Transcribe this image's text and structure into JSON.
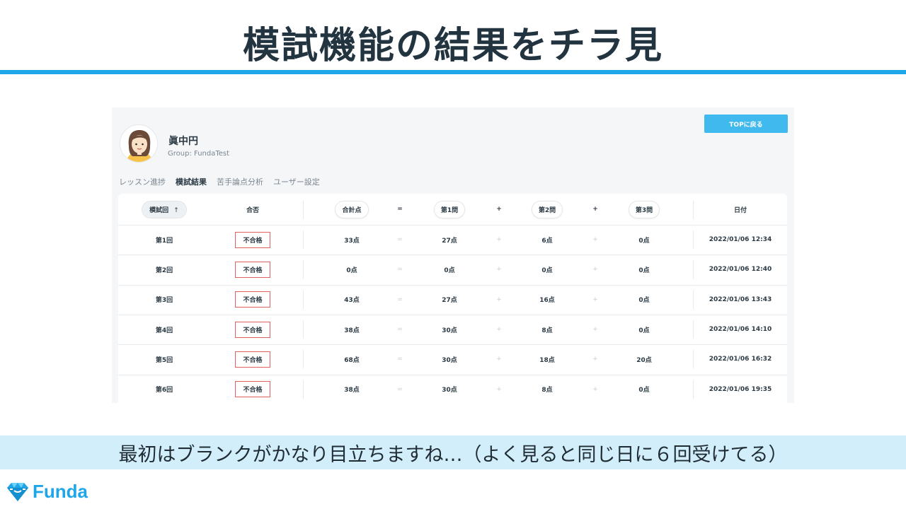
{
  "slide": {
    "title": "模試機能の結果をチラ見",
    "caption": "最初はブランクがかなり目立ちますね…（よく見ると同じ日に６回受けてる）",
    "logo_text": "Funda",
    "accent_color": "#1ea6e8"
  },
  "app": {
    "user": {
      "name": "眞中円",
      "group": "Group: FundaTest"
    },
    "top_button": "TOPに戻る",
    "tabs": [
      {
        "label": "レッスン進捗",
        "active": false
      },
      {
        "label": "模試結果",
        "active": true
      },
      {
        "label": "苦手論点分析",
        "active": false
      },
      {
        "label": "ユーザー設定",
        "active": false
      }
    ],
    "table": {
      "headers": {
        "round": "模試回",
        "sort_icon": "↑",
        "result": "合否",
        "total": "合計点",
        "eq": "=",
        "q1": "第1問",
        "plus": "+",
        "q2": "第2問",
        "q3": "第3問",
        "date": "日付"
      },
      "rows": [
        {
          "round": "第1回",
          "result": "不合格",
          "total": "33点",
          "q1": "27点",
          "q2": "6点",
          "q3": "0点",
          "date": "2022/01/06 12:34"
        },
        {
          "round": "第2回",
          "result": "不合格",
          "total": "0点",
          "q1": "0点",
          "q2": "0点",
          "q3": "0点",
          "date": "2022/01/06 12:40"
        },
        {
          "round": "第3回",
          "result": "不合格",
          "total": "43点",
          "q1": "27点",
          "q2": "16点",
          "q3": "0点",
          "date": "2022/01/06 13:43"
        },
        {
          "round": "第4回",
          "result": "不合格",
          "total": "38点",
          "q1": "30点",
          "q2": "8点",
          "q3": "0点",
          "date": "2022/01/06 14:10"
        },
        {
          "round": "第5回",
          "result": "不合格",
          "total": "68点",
          "q1": "30点",
          "q2": "18点",
          "q3": "20点",
          "date": "2022/01/06 16:32"
        },
        {
          "round": "第6回",
          "result": "不合格",
          "total": "38点",
          "q1": "30点",
          "q2": "8点",
          "q3": "0点",
          "date": "2022/01/06 19:35"
        }
      ]
    }
  }
}
